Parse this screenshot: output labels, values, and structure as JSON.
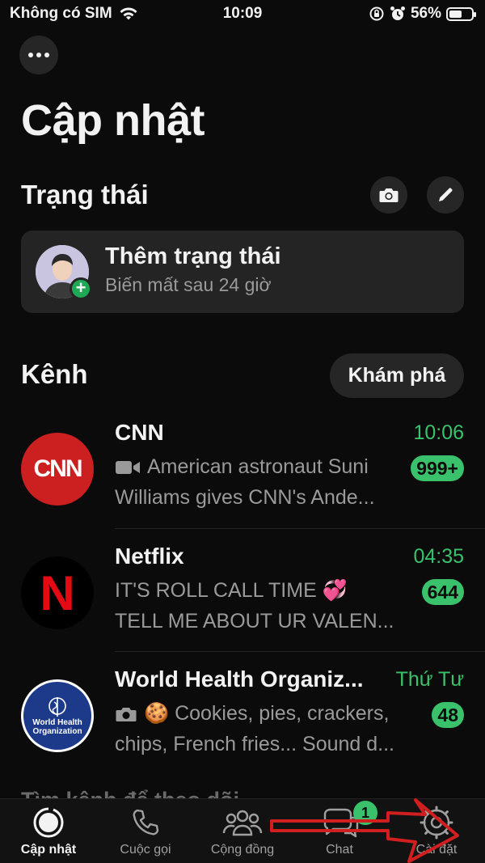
{
  "status_bar": {
    "carrier": "Không có SIM",
    "time": "10:09",
    "battery": "56%",
    "battery_level": 0.56
  },
  "page": {
    "title": "Cập nhật"
  },
  "status_section": {
    "title": "Trạng thái",
    "camera_icon": "camera-icon",
    "edit_icon": "pencil-icon",
    "card": {
      "title": "Thêm trạng thái",
      "subtitle": "Biến mất sau 24 giờ"
    }
  },
  "channels_section": {
    "title": "Kênh",
    "explore_label": "Khám phá",
    "items": [
      {
        "name": "CNN",
        "time": "10:06",
        "line1": "American astronaut Suni",
        "line2": "Williams gives CNN's Ande...",
        "badge": "999+",
        "logo_text": "CNN",
        "line_icon": "video-icon"
      },
      {
        "name": "Netflix",
        "time": "04:35",
        "line1": "IT'S ROLL CALL TIME 💞",
        "line2": "TELL ME ABOUT UR VALEN...",
        "badge": "644",
        "logo_text": "N"
      },
      {
        "name": "World Health Organiz...",
        "time": "Thứ Tư",
        "line1": "🍪 Cookies, pies, crackers,",
        "line2": "chips, French fries... Sound d...",
        "badge": "48",
        "logo_text_1": "World Health",
        "logo_text_2": "Organization",
        "line_icon": "camera-icon"
      }
    ],
    "find_more": "Tìm kênh để theo dõi"
  },
  "tab_bar": {
    "tabs": [
      {
        "label": "Cập nhật",
        "icon": "updates-icon",
        "active": true
      },
      {
        "label": "Cuộc gọi",
        "icon": "phone-icon"
      },
      {
        "label": "Cộng đồng",
        "icon": "community-icon"
      },
      {
        "label": "Chat",
        "icon": "chat-icon",
        "badge": "1"
      },
      {
        "label": "Cài đặt",
        "icon": "gear-icon"
      }
    ]
  },
  "colors": {
    "accent": "#39c26b",
    "background": "#0b0b0b",
    "card": "#242424",
    "annotation_arrow": "#d11f1f"
  }
}
